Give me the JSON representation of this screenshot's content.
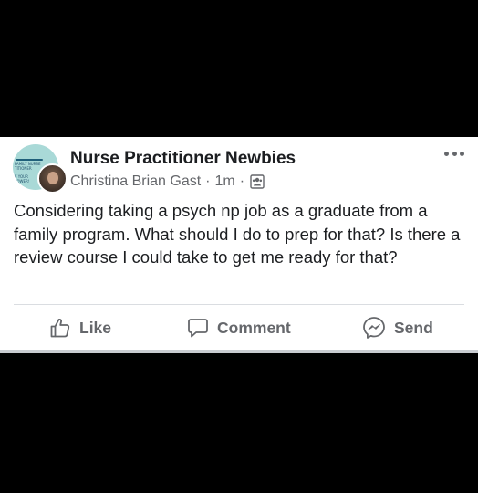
{
  "post": {
    "group_name": "Nurse Practitioner Newbies",
    "author": "Christina Brian Gast",
    "separator": "·",
    "time": "1m",
    "text": "Considering taking a psych np job as a graduate from a family program. What should I do to prep for that? Is there a review course I could take to get me ready for that?",
    "group_avatar_text": [
      "FAMILY NURSE",
      "TITIONER",
      "E YOUR",
      "POWER!"
    ]
  },
  "actions": {
    "like_label": "Like",
    "comment_label": "Comment",
    "send_label": "Send"
  },
  "icons": {
    "more": "more-horizontal-icon",
    "privacy": "group-members-icon",
    "like": "thumbs-up-icon",
    "comment": "speech-bubble-icon",
    "send": "messenger-icon"
  },
  "colors": {
    "primary_text": "#1c1e21",
    "secondary_text": "#65676b",
    "divider": "#dadde1",
    "background": "#000000",
    "card": "#ffffff"
  }
}
